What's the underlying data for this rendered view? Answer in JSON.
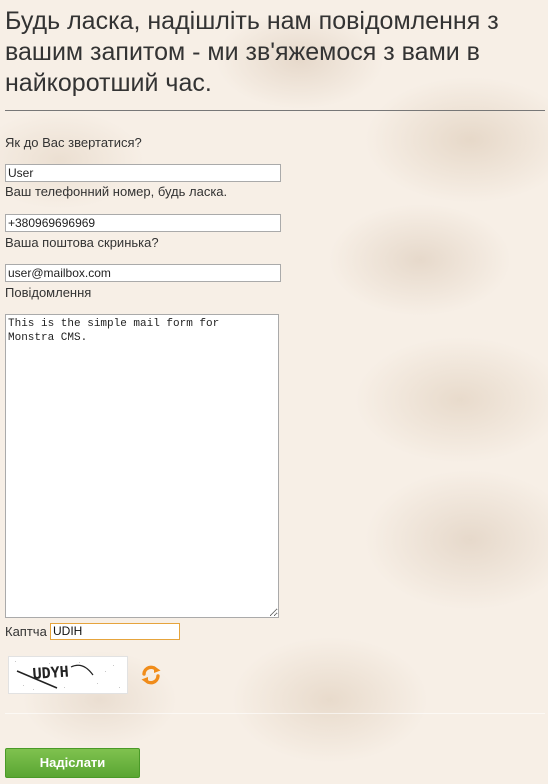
{
  "header": {
    "title": "Будь ласка, надішліть нам повідомлення з вашим запитом - ми зв'яжемося з вами в найкоротший час."
  },
  "form": {
    "name_label": "Як до Вас звертатися?",
    "name_value": "User",
    "phone_label": "Ваш телефонний номер, будь ласка.",
    "phone_value": "+380969696969",
    "email_label": "Ваша поштова скринька?",
    "email_value": "user@mailbox.com",
    "message_label": "Повідомлення",
    "message_value": "This is the simple mail form for\nMonstra CMS.",
    "captcha_label": "Каптча",
    "captcha_value": "UDIH",
    "captcha_image_text": "UDYH",
    "refresh_icon": "refresh-icon",
    "submit_label": "Надіслати"
  },
  "colors": {
    "submit_bg": "#6bb43f",
    "captcha_border": "#e6a43c",
    "refresh_orange": "#f08c1a"
  }
}
